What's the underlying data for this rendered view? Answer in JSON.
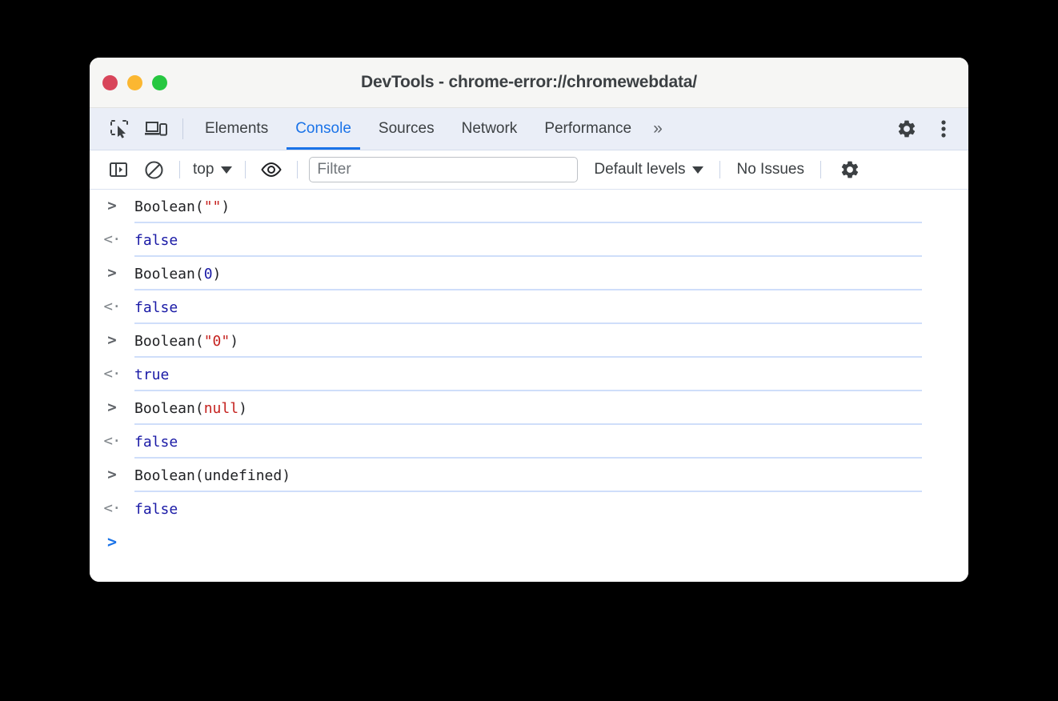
{
  "window": {
    "title": "DevTools - chrome-error://chromewebdata/",
    "traffic_lights": [
      {
        "name": "close-button",
        "color": "#d8455a"
      },
      {
        "name": "minimize-button",
        "color": "#fbb731"
      },
      {
        "name": "maximize-button",
        "color": "#26c740"
      }
    ]
  },
  "tabbar": {
    "inspect_icon": "inspect-element-icon",
    "device_icon": "device-toolbar-icon",
    "tabs": [
      {
        "label": "Elements",
        "active": false
      },
      {
        "label": "Console",
        "active": true
      },
      {
        "label": "Sources",
        "active": false
      },
      {
        "label": "Network",
        "active": false
      },
      {
        "label": "Performance",
        "active": false
      }
    ],
    "more_tabs_label": "»",
    "settings_icon": "gear-icon",
    "menu_icon": "more-vertical-icon",
    "active_color": "#1a73e8"
  },
  "console_toolbar": {
    "sidebar_toggle_icon": "sidebar-toggle-icon",
    "clear_console_icon": "clear-console-icon",
    "context_selector": "top",
    "live_expression_icon": "eye-icon",
    "filter_placeholder": "Filter",
    "filter_value": "",
    "levels_label": "Default levels",
    "issues_label": "No Issues",
    "settings_icon": "gear-icon"
  },
  "console": {
    "entries": [
      {
        "kind": "input",
        "gutter": ">",
        "tokens": [
          {
            "text": "Boolean(",
            "type": "plain"
          },
          {
            "text": "\"\"",
            "type": "string"
          },
          {
            "text": ")",
            "type": "plain"
          }
        ],
        "plain": "Boolean(\"\")"
      },
      {
        "kind": "output",
        "gutter": "<·",
        "value": "false"
      },
      {
        "kind": "input",
        "gutter": ">",
        "tokens": [
          {
            "text": "Boolean(",
            "type": "plain"
          },
          {
            "text": "0",
            "type": "number"
          },
          {
            "text": ")",
            "type": "plain"
          }
        ],
        "plain": "Boolean(0)"
      },
      {
        "kind": "output",
        "gutter": "<·",
        "value": "false"
      },
      {
        "kind": "input",
        "gutter": ">",
        "tokens": [
          {
            "text": "Boolean(",
            "type": "plain"
          },
          {
            "text": "\"0\"",
            "type": "string"
          },
          {
            "text": ")",
            "type": "plain"
          }
        ],
        "plain": "Boolean(\"0\")"
      },
      {
        "kind": "output",
        "gutter": "<·",
        "value": "true"
      },
      {
        "kind": "input",
        "gutter": ">",
        "tokens": [
          {
            "text": "Boolean(",
            "type": "plain"
          },
          {
            "text": "null",
            "type": "keyword"
          },
          {
            "text": ")",
            "type": "plain"
          }
        ],
        "plain": "Boolean(null)"
      },
      {
        "kind": "output",
        "gutter": "<·",
        "value": "false"
      },
      {
        "kind": "input",
        "gutter": ">",
        "tokens": [
          {
            "text": "Boolean(undefined)",
            "type": "plain"
          }
        ],
        "plain": "Boolean(undefined)"
      },
      {
        "kind": "output",
        "gutter": "<·",
        "value": "false"
      }
    ],
    "prompt_gutter": ">",
    "prompt_value": ""
  },
  "colors": {
    "string": "#c5221f",
    "number": "#1a1aa6",
    "keyword": "#c5221f",
    "result": "#1a1aa6",
    "rule": "#cfdefa"
  }
}
